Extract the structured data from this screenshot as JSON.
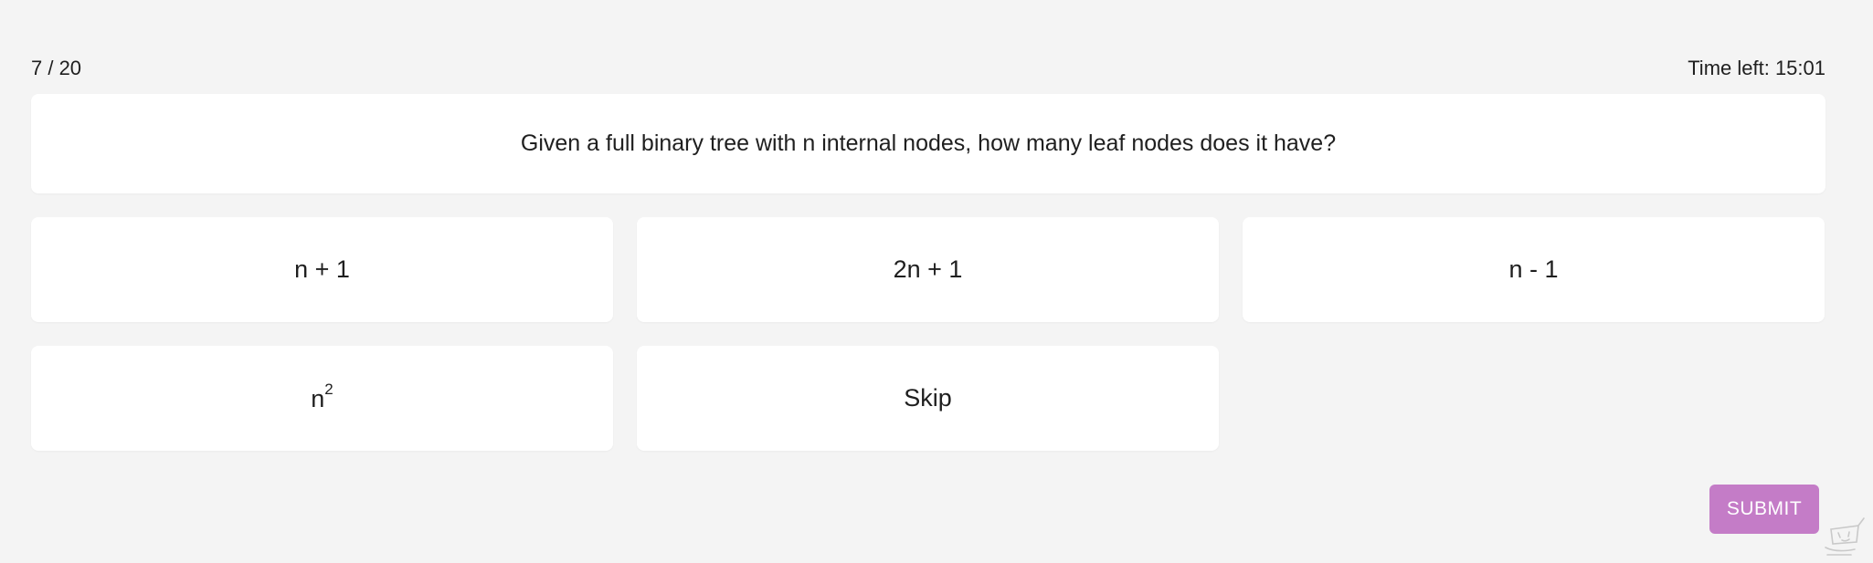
{
  "header": {
    "progress": "7 / 20",
    "timer": "Time left: 15:01"
  },
  "question": {
    "text": "Given a full binary tree with n internal nodes, how many leaf nodes does it have?"
  },
  "options": {
    "a": "n + 1",
    "b": "2n + 1",
    "c": "n - 1",
    "d_base": "n",
    "d_exponent": "2",
    "skip": "Skip"
  },
  "actions": {
    "submit_label": "SUBMIT"
  },
  "colors": {
    "background": "#f4f4f4",
    "card": "#ffffff",
    "submit": "#c47cc7"
  },
  "icons": {
    "watermark": "mascot-watermark-icon"
  }
}
